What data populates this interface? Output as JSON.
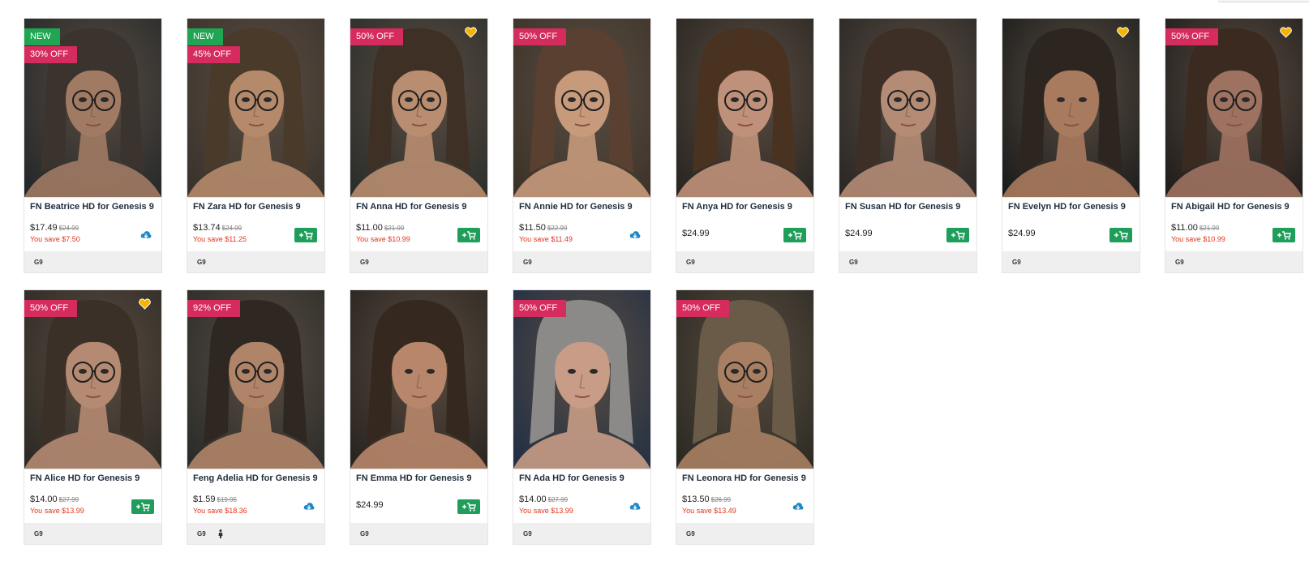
{
  "products": [
    {
      "title": "FN Beatrice HD for Genesis 9",
      "labels": [
        {
          "text": "NEW",
          "kind": "new"
        },
        {
          "text": "30% OFF",
          "kind": "off"
        }
      ],
      "price": "$17.49",
      "old_price": "$24.99",
      "save": "You save $7.50",
      "action": "download-icon",
      "heart": false,
      "tags": [
        "G9"
      ],
      "hair": "#3b332d",
      "skin": "#a07a63",
      "bg": "#25282a",
      "glasses": true
    },
    {
      "title": "FN Zara HD for Genesis 9",
      "labels": [
        {
          "text": "NEW",
          "kind": "new"
        },
        {
          "text": "45% OFF",
          "kind": "off"
        }
      ],
      "price": "$13.74",
      "old_price": "$24.99",
      "save": "You save $11.25",
      "action": "add-to-cart-icon",
      "heart": false,
      "tags": [
        "G9"
      ],
      "hair": "#4a3a2a",
      "skin": "#b58a6b",
      "bg": "#3a332c",
      "glasses": true
    },
    {
      "title": "FN Anna HD for Genesis 9",
      "labels": [
        {
          "text": "50% OFF",
          "kind": "off"
        }
      ],
      "price": "$11.00",
      "old_price": "$21.99",
      "save": "You save $10.99",
      "action": "add-to-cart-icon",
      "heart": true,
      "tags": [
        "G9"
      ],
      "hair": "#3e3024",
      "skin": "#b88d70",
      "bg": "#2c2e2b",
      "glasses": true
    },
    {
      "title": "FN Annie HD for Genesis 9",
      "labels": [
        {
          "text": "50% OFF",
          "kind": "off"
        }
      ],
      "price": "$11.50",
      "old_price": "$22.99",
      "save": "You save $11.49",
      "action": "download-icon",
      "heart": false,
      "tags": [
        "G9"
      ],
      "hair": "#5a4030",
      "skin": "#c79a7c",
      "bg": "#3c3328",
      "glasses": true
    },
    {
      "title": "FN Anya HD for Genesis 9",
      "labels": [],
      "price": "$24.99",
      "old_price": "",
      "save": "",
      "action": "add-to-cart-icon",
      "heart": false,
      "tags": [
        "G9"
      ],
      "hair": "#4a3221",
      "skin": "#c0917a",
      "bg": "#2a2622",
      "glasses": true
    },
    {
      "title": "FN Susan HD for Genesis 9",
      "labels": [],
      "price": "$24.99",
      "old_price": "",
      "save": "",
      "action": "add-to-cart-icon",
      "heart": false,
      "tags": [
        "G9"
      ],
      "hair": "#3d2f26",
      "skin": "#b48c76",
      "bg": "#2b2826",
      "glasses": true
    },
    {
      "title": "FN Evelyn HD for Genesis 9",
      "labels": [],
      "price": "$24.99",
      "old_price": "",
      "save": "",
      "action": "add-to-cart-icon",
      "heart": true,
      "tags": [
        "G9"
      ],
      "hair": "#2d2520",
      "skin": "#a87a5e",
      "bg": "#1c1d1c",
      "glasses": false
    },
    {
      "title": "FN Abigail HD for Genesis 9",
      "labels": [
        {
          "text": "50% OFF",
          "kind": "off"
        }
      ],
      "price": "$11.00",
      "old_price": "$21.99",
      "save": "You save $10.99",
      "action": "add-to-cart-icon",
      "heart": true,
      "tags": [
        "G9"
      ],
      "hair": "#3a2a20",
      "skin": "#9e7260",
      "bg": "#221e1c",
      "glasses": true
    },
    {
      "title": "FN Alice HD for Genesis 9",
      "labels": [
        {
          "text": "50% OFF",
          "kind": "off"
        }
      ],
      "price": "$14.00",
      "old_price": "$27.99",
      "save": "You save $13.99",
      "action": "add-to-cart-icon",
      "heart": true,
      "tags": [
        "G9"
      ],
      "hair": "#3b3028",
      "skin": "#b58a72",
      "bg": "#2e2a25",
      "glasses": true
    },
    {
      "title": "Feng Adelia HD for Genesis 9",
      "labels": [
        {
          "text": "92% OFF",
          "kind": "off"
        }
      ],
      "price": "$1.59",
      "old_price": "$19.95",
      "save": "You save $18.36",
      "action": "download-icon",
      "heart": false,
      "tags": [
        "G9",
        "person-icon"
      ],
      "hair": "#2e2722",
      "skin": "#b08468",
      "bg": "#2b2c29",
      "glasses": true
    },
    {
      "title": "FN Emma HD for Genesis 9",
      "labels": [],
      "price": "$24.99",
      "old_price": "",
      "save": "",
      "action": "add-to-cart-icon",
      "heart": false,
      "tags": [
        "G9"
      ],
      "hair": "#35281f",
      "skin": "#b8866a",
      "bg": "#2a2420",
      "glasses": false
    },
    {
      "title": "FN Ada HD for Genesis 9",
      "labels": [
        {
          "text": "50% OFF",
          "kind": "off"
        }
      ],
      "price": "$14.00",
      "old_price": "$27.99",
      "save": "You save $13.99",
      "action": "download-icon",
      "heart": false,
      "tags": [
        "G9"
      ],
      "hair": "#8c8a88",
      "skin": "#c89c86",
      "bg": "#223044",
      "glasses": false
    },
    {
      "title": "FN Leonora HD for Genesis 9",
      "labels": [
        {
          "text": "50% OFF",
          "kind": "off"
        }
      ],
      "price": "$13.50",
      "old_price": "$26.99",
      "save": "You save $13.49",
      "action": "download-icon",
      "heart": false,
      "tags": [
        "G9"
      ],
      "hair": "#6a5a48",
      "skin": "#a97f63",
      "bg": "#2b2a22",
      "glasses": true
    }
  ],
  "colors": {
    "new_label": "#20a553",
    "sale_label": "#d52b5d",
    "cart_button": "#1f9d5b",
    "download_icon": "#1e88c7",
    "save_text": "#e0341a",
    "heart": "#f5b400"
  }
}
